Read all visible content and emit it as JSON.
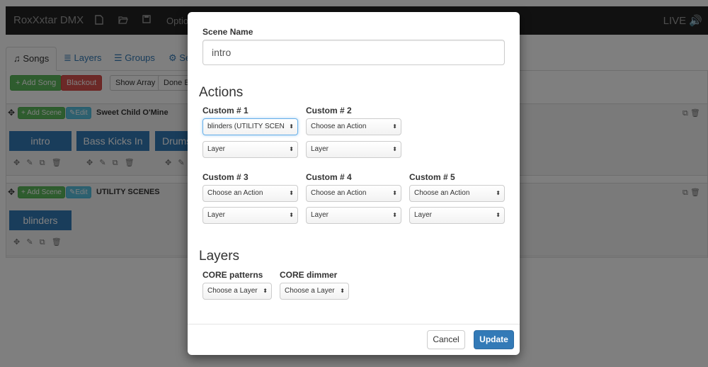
{
  "app": {
    "brand": "RoxXxtar DMX",
    "options_label": "Optio",
    "live_label": "LIVE",
    "icons": [
      "file-icon",
      "folder-open-icon",
      "save-icon",
      "volume-icon"
    ]
  },
  "tabs": [
    {
      "label": "Songs",
      "icon": "music-icon"
    },
    {
      "label": "Layers",
      "icon": "database-icon"
    },
    {
      "label": "Groups",
      "icon": "list-icon"
    },
    {
      "label": "Se",
      "icon": "cogs-icon"
    }
  ],
  "toolbar": {
    "add_song": "+ Add Song",
    "blackout": "Blackout",
    "show_array": "Show Array",
    "done_edit": "Done Ed"
  },
  "songs": [
    {
      "add_scene": "+ Add Scene",
      "edit": "Edit",
      "title": "Sweet Child O'Mine",
      "scenes": [
        "intro",
        "Bass Kicks In",
        "Drums"
      ]
    },
    {
      "add_scene": "+ Add Scene",
      "edit": "Edit",
      "title": "UTILITY SCENES",
      "scenes": [
        "blinders"
      ]
    }
  ],
  "modal": {
    "scene_name_label": "Scene Name",
    "scene_name_value": "intro",
    "actions_heading": "Actions",
    "customs": [
      {
        "label": "Custom # 1",
        "action": "blinders (UTILITY SCENES)",
        "layer": "Layer",
        "focused": true
      },
      {
        "label": "Custom # 2",
        "action": "Choose an Action",
        "layer": "Layer"
      },
      {
        "label": "Custom # 3",
        "action": "Choose an Action",
        "layer": "Layer"
      },
      {
        "label": "Custom # 4",
        "action": "Choose an Action",
        "layer": "Layer"
      },
      {
        "label": "Custom # 5",
        "action": "Choose an Action",
        "layer": "Layer"
      }
    ],
    "layers_heading": "Layers",
    "layers": [
      {
        "label": "CORE patterns",
        "value": "Choose a Layer"
      },
      {
        "label": "CORE dimmer",
        "value": "Choose a Layer"
      }
    ],
    "cancel": "Cancel",
    "update": "Update"
  },
  "colors": {
    "primary": "#337ab7",
    "success": "#5cb85c",
    "danger": "#d9534f",
    "info": "#5bc0de",
    "navbar": "#222222"
  }
}
